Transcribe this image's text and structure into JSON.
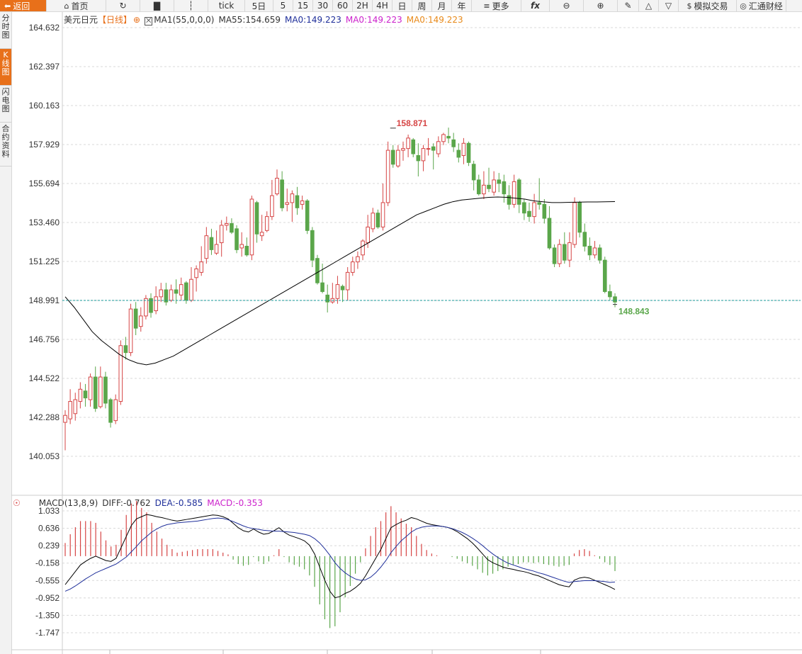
{
  "toolbar": {
    "back_label": "返回",
    "home_label": "首页",
    "tick_label": "tick",
    "five_day_label": "5日",
    "periods": [
      "5",
      "15",
      "30",
      "60",
      "2H",
      "4H",
      "日",
      "周",
      "月",
      "年"
    ],
    "more_label": "更多",
    "fx_label": "fx",
    "simulate_label": "模拟交易",
    "brand_label": "汇通财经"
  },
  "sidebar": {
    "tabs": [
      "分时图",
      "K线图",
      "闪电图",
      "合约资料"
    ],
    "active": 1
  },
  "main_legend": {
    "symbol": "美元日元",
    "period": "【日线】",
    "ma1": "MA1(55,0,0,0)",
    "ma55": "MA55:154.659",
    "ma0_a": "MA0:149.223",
    "ma0_b": "MA0:149.223",
    "ma0_c": "MA0:149.223"
  },
  "macd_legend": {
    "name": "MACD(13,8,9)",
    "diff": "DIFF:-0.762",
    "dea": "DEA:-0.585",
    "macd": "MACD:-0.353"
  },
  "colors": {
    "up": "#d64545",
    "down": "#5aa64a",
    "ma": "#000000",
    "diff": "#000000",
    "dea": "#1f2f9a",
    "macd_label": "#cc22cc",
    "dea_label": "#1f2f9a",
    "ma0_a": "#1f2f9a",
    "ma0_b": "#cc22cc",
    "ma0_c": "#e88a1a",
    "last_line": "#1a9a9a",
    "accent": "#e8701a"
  },
  "chart_data": {
    "type": "candlestick",
    "yticks": [
      "164.632",
      "162.397",
      "160.163",
      "157.929",
      "155.694",
      "153.460",
      "151.225",
      "148.991",
      "146.756",
      "144.522",
      "142.288",
      "140.053"
    ],
    "ylim": [
      140.053,
      164.632
    ],
    "high_label": "158.871",
    "high_value": 158.871,
    "high_index": 65,
    "last_label": "148.843",
    "last_value": 148.843,
    "last_line_value": 148.991,
    "candles": [
      [
        142.0,
        142.4,
        140.4,
        142.7
      ],
      [
        142.2,
        143.2,
        141.9,
        143.9
      ],
      [
        142.5,
        143.3,
        142.1,
        143.7
      ],
      [
        143.2,
        143.9,
        142.8,
        144.3
      ],
      [
        143.8,
        143.4,
        142.9,
        144.2
      ],
      [
        143.3,
        144.6,
        142.9,
        144.8
      ],
      [
        144.6,
        142.8,
        142.6,
        145.2
      ],
      [
        142.9,
        144.6,
        142.8,
        145.2
      ],
      [
        144.6,
        143.1,
        142.8,
        144.9
      ],
      [
        143.3,
        142.0,
        141.7,
        143.4
      ],
      [
        142.1,
        143.3,
        141.9,
        143.6
      ],
      [
        143.2,
        146.4,
        143.0,
        146.7
      ],
      [
        146.4,
        146.0,
        145.6,
        146.9
      ],
      [
        146.0,
        148.5,
        145.8,
        148.8
      ],
      [
        148.5,
        147.4,
        147.0,
        148.9
      ],
      [
        147.5,
        148.1,
        147.2,
        148.6
      ],
      [
        148.1,
        149.1,
        147.9,
        149.3
      ],
      [
        149.1,
        148.3,
        148.0,
        149.4
      ],
      [
        148.4,
        149.2,
        148.2,
        149.8
      ],
      [
        149.2,
        149.6,
        148.9,
        150.0
      ],
      [
        149.6,
        148.9,
        148.7,
        150.0
      ],
      [
        149.0,
        149.6,
        148.9,
        149.9
      ],
      [
        149.6,
        149.4,
        148.8,
        150.2
      ],
      [
        149.3,
        149.9,
        149.0,
        150.3
      ],
      [
        150.0,
        149.0,
        148.8,
        150.1
      ],
      [
        149.0,
        150.2,
        148.9,
        150.9
      ],
      [
        150.3,
        150.8,
        149.5,
        151.0
      ],
      [
        150.6,
        151.2,
        150.4,
        152.1
      ],
      [
        151.4,
        152.7,
        151.1,
        153.2
      ],
      [
        152.6,
        151.9,
        151.6,
        153.1
      ],
      [
        151.7,
        152.2,
        151.6,
        153.0
      ],
      [
        152.3,
        153.3,
        151.5,
        153.6
      ],
      [
        153.3,
        153.4,
        153.0,
        153.8
      ],
      [
        153.4,
        152.9,
        152.8,
        153.7
      ],
      [
        153.1,
        151.9,
        151.7,
        153.3
      ],
      [
        152.0,
        152.2,
        151.5,
        152.9
      ],
      [
        152.1,
        151.6,
        151.5,
        152.6
      ],
      [
        151.6,
        154.8,
        151.3,
        155.0
      ],
      [
        154.6,
        152.8,
        152.3,
        154.7
      ],
      [
        152.7,
        152.9,
        152.4,
        153.9
      ],
      [
        153.0,
        153.8,
        152.9,
        154.1
      ],
      [
        153.8,
        155.0,
        153.6,
        155.9
      ],
      [
        155.1,
        156.0,
        155.0,
        156.5
      ],
      [
        155.9,
        154.3,
        154.1,
        156.4
      ],
      [
        154.5,
        154.6,
        154.1,
        155.4
      ],
      [
        154.6,
        155.1,
        153.5,
        155.3
      ],
      [
        155.0,
        154.3,
        153.9,
        155.5
      ],
      [
        154.5,
        154.7,
        154.2,
        155.0
      ],
      [
        154.7,
        153.0,
        152.8,
        154.8
      ],
      [
        153.0,
        151.3,
        150.9,
        153.2
      ],
      [
        151.4,
        150.0,
        149.9,
        151.6
      ],
      [
        150.0,
        149.5,
        149.4,
        151.1
      ],
      [
        149.3,
        148.9,
        148.3,
        149.9
      ],
      [
        148.9,
        149.1,
        148.8,
        150.0
      ],
      [
        149.1,
        149.9,
        148.8,
        150.4
      ],
      [
        149.8,
        149.6,
        148.9,
        149.9
      ],
      [
        149.6,
        150.6,
        149.0,
        150.9
      ],
      [
        150.6,
        151.2,
        150.4,
        151.5
      ],
      [
        151.2,
        151.5,
        150.8,
        151.8
      ],
      [
        151.6,
        152.4,
        151.3,
        152.5
      ],
      [
        152.3,
        153.2,
        152.0,
        153.9
      ],
      [
        153.1,
        154.0,
        152.9,
        154.3
      ],
      [
        154.0,
        153.2,
        153.1,
        154.2
      ],
      [
        153.2,
        154.6,
        153.0,
        155.7
      ],
      [
        154.6,
        157.6,
        154.4,
        158.1
      ],
      [
        157.6,
        156.8,
        156.6,
        157.9
      ],
      [
        156.7,
        157.6,
        156.6,
        157.9
      ],
      [
        157.6,
        157.7,
        157.0,
        158.1
      ],
      [
        157.7,
        158.3,
        157.2,
        158.5
      ],
      [
        158.2,
        157.4,
        157.2,
        158.3
      ],
      [
        157.3,
        157.0,
        156.1,
        158.0
      ],
      [
        157.0,
        157.7,
        156.4,
        157.9
      ],
      [
        157.7,
        157.7,
        157.3,
        158.3
      ],
      [
        157.8,
        157.6,
        156.5,
        158.0
      ],
      [
        157.4,
        158.1,
        157.2,
        158.4
      ],
      [
        158.1,
        158.5,
        157.9,
        158.6
      ],
      [
        158.4,
        158.3,
        158.0,
        158.9
      ],
      [
        158.2,
        157.8,
        157.5,
        158.6
      ],
      [
        157.6,
        157.2,
        156.9,
        158.0
      ],
      [
        157.3,
        158.0,
        156.8,
        158.3
      ],
      [
        158.0,
        156.9,
        156.7,
        158.1
      ],
      [
        156.8,
        155.9,
        155.3,
        157.0
      ],
      [
        155.9,
        155.1,
        155.0,
        156.2
      ],
      [
        155.1,
        155.6,
        154.8,
        156.4
      ],
      [
        155.6,
        155.4,
        155.2,
        156.6
      ],
      [
        155.2,
        155.9,
        155.0,
        156.4
      ],
      [
        155.9,
        155.7,
        155.2,
        156.3
      ],
      [
        155.8,
        155.1,
        154.6,
        156.2
      ],
      [
        155.0,
        154.5,
        154.2,
        155.6
      ],
      [
        154.5,
        155.8,
        154.3,
        156.2
      ],
      [
        155.9,
        154.5,
        154.0,
        156.0
      ],
      [
        154.6,
        154.0,
        153.6,
        154.8
      ],
      [
        154.1,
        153.8,
        153.5,
        154.6
      ],
      [
        153.8,
        154.6,
        153.4,
        155.1
      ],
      [
        154.6,
        154.5,
        154.2,
        156.0
      ],
      [
        154.5,
        153.7,
        153.4,
        154.8
      ],
      [
        153.7,
        152.0,
        151.9,
        154.4
      ],
      [
        152.0,
        151.1,
        150.9,
        152.2
      ],
      [
        151.1,
        152.2,
        150.9,
        152.5
      ],
      [
        152.2,
        151.3,
        151.1,
        152.9
      ],
      [
        151.3,
        152.3,
        150.9,
        152.9
      ],
      [
        152.2,
        154.6,
        152.0,
        154.9
      ],
      [
        154.6,
        152.9,
        152.6,
        154.7
      ],
      [
        152.9,
        152.1,
        151.8,
        153.4
      ],
      [
        152.1,
        151.6,
        151.3,
        152.6
      ],
      [
        151.6,
        152.0,
        151.4,
        152.4
      ],
      [
        152.0,
        151.3,
        151.1,
        152.2
      ],
      [
        151.3,
        149.5,
        149.4,
        151.5
      ],
      [
        149.5,
        149.2,
        149.0,
        149.9
      ],
      [
        149.2,
        148.9,
        148.6,
        149.4
      ]
    ],
    "ma55": [
      149.2,
      148.6,
      147.9,
      147.2,
      146.7,
      146.3,
      145.9,
      145.6,
      145.4,
      145.3,
      145.4,
      145.6,
      145.8,
      146.1,
      146.4,
      146.7,
      147.0,
      147.3,
      147.6,
      147.9,
      148.2,
      148.5,
      148.8,
      149.1,
      149.4,
      149.7,
      150.0,
      150.3,
      150.6,
      150.9,
      151.2,
      151.5,
      151.8,
      152.1,
      152.4,
      152.7,
      153.0,
      153.3,
      153.6,
      153.9,
      154.1,
      154.3,
      154.5,
      154.65,
      154.75,
      154.8,
      154.85,
      154.9,
      154.92,
      154.9,
      154.85,
      154.8,
      154.7,
      154.65,
      154.6,
      154.6,
      154.62,
      154.63,
      154.64,
      154.64,
      154.65,
      154.66
    ],
    "ma55_start": 0,
    "macd_yticks": [
      "1.033",
      "0.636",
      "0.239",
      "-0.158",
      "-0.555",
      "-0.952",
      "-1.350",
      "-1.747"
    ],
    "macd_ylim": [
      -1.747,
      1.033
    ],
    "diff": [
      -0.65,
      -0.5,
      -0.35,
      -0.2,
      -0.12,
      -0.05,
      0.0,
      -0.05,
      -0.1,
      -0.12,
      -0.05,
      0.2,
      0.45,
      0.7,
      0.85,
      0.9,
      0.95,
      0.93,
      0.9,
      0.88,
      0.85,
      0.82,
      0.8,
      0.82,
      0.84,
      0.86,
      0.88,
      0.9,
      0.92,
      0.94,
      0.93,
      0.9,
      0.85,
      0.75,
      0.65,
      0.58,
      0.55,
      0.62,
      0.55,
      0.5,
      0.52,
      0.58,
      0.65,
      0.55,
      0.48,
      0.44,
      0.4,
      0.35,
      0.25,
      0.05,
      -0.25,
      -0.55,
      -0.8,
      -0.95,
      -0.92,
      -0.85,
      -0.8,
      -0.72,
      -0.62,
      -0.45,
      -0.25,
      -0.05,
      0.15,
      0.4,
      0.65,
      0.72,
      0.78,
      0.82,
      0.88,
      0.85,
      0.8,
      0.75,
      0.72,
      0.7,
      0.68,
      0.66,
      0.62,
      0.56,
      0.48,
      0.4,
      0.3,
      0.18,
      0.05,
      -0.08,
      -0.15,
      -0.2,
      -0.25,
      -0.28,
      -0.3,
      -0.33,
      -0.35,
      -0.38,
      -0.42,
      -0.45,
      -0.5,
      -0.55,
      -0.6,
      -0.65,
      -0.68,
      -0.7,
      -0.55,
      -0.5,
      -0.48,
      -0.5,
      -0.55,
      -0.6,
      -0.65,
      -0.7,
      -0.76
    ],
    "dea": [
      -0.8,
      -0.75,
      -0.68,
      -0.6,
      -0.52,
      -0.45,
      -0.38,
      -0.33,
      -0.28,
      -0.23,
      -0.18,
      -0.1,
      -0.02,
      0.1,
      0.22,
      0.35,
      0.45,
      0.55,
      0.62,
      0.68,
      0.72,
      0.74,
      0.76,
      0.77,
      0.78,
      0.79,
      0.8,
      0.82,
      0.84,
      0.86,
      0.87,
      0.86,
      0.83,
      0.79,
      0.74,
      0.69,
      0.65,
      0.63,
      0.61,
      0.59,
      0.58,
      0.57,
      0.57,
      0.56,
      0.55,
      0.54,
      0.52,
      0.5,
      0.47,
      0.4,
      0.3,
      0.17,
      0.02,
      -0.15,
      -0.28,
      -0.38,
      -0.46,
      -0.52,
      -0.55,
      -0.54,
      -0.48,
      -0.38,
      -0.25,
      -0.1,
      0.08,
      0.22,
      0.35,
      0.45,
      0.55,
      0.62,
      0.66,
      0.68,
      0.69,
      0.69,
      0.68,
      0.66,
      0.63,
      0.59,
      0.54,
      0.48,
      0.41,
      0.33,
      0.24,
      0.14,
      0.05,
      -0.03,
      -0.1,
      -0.16,
      -0.2,
      -0.24,
      -0.28,
      -0.31,
      -0.34,
      -0.38,
      -0.41,
      -0.45,
      -0.49,
      -0.53,
      -0.57,
      -0.6,
      -0.58,
      -0.57,
      -0.56,
      -0.56,
      -0.56,
      -0.57,
      -0.58,
      -0.6,
      -0.59
    ]
  }
}
